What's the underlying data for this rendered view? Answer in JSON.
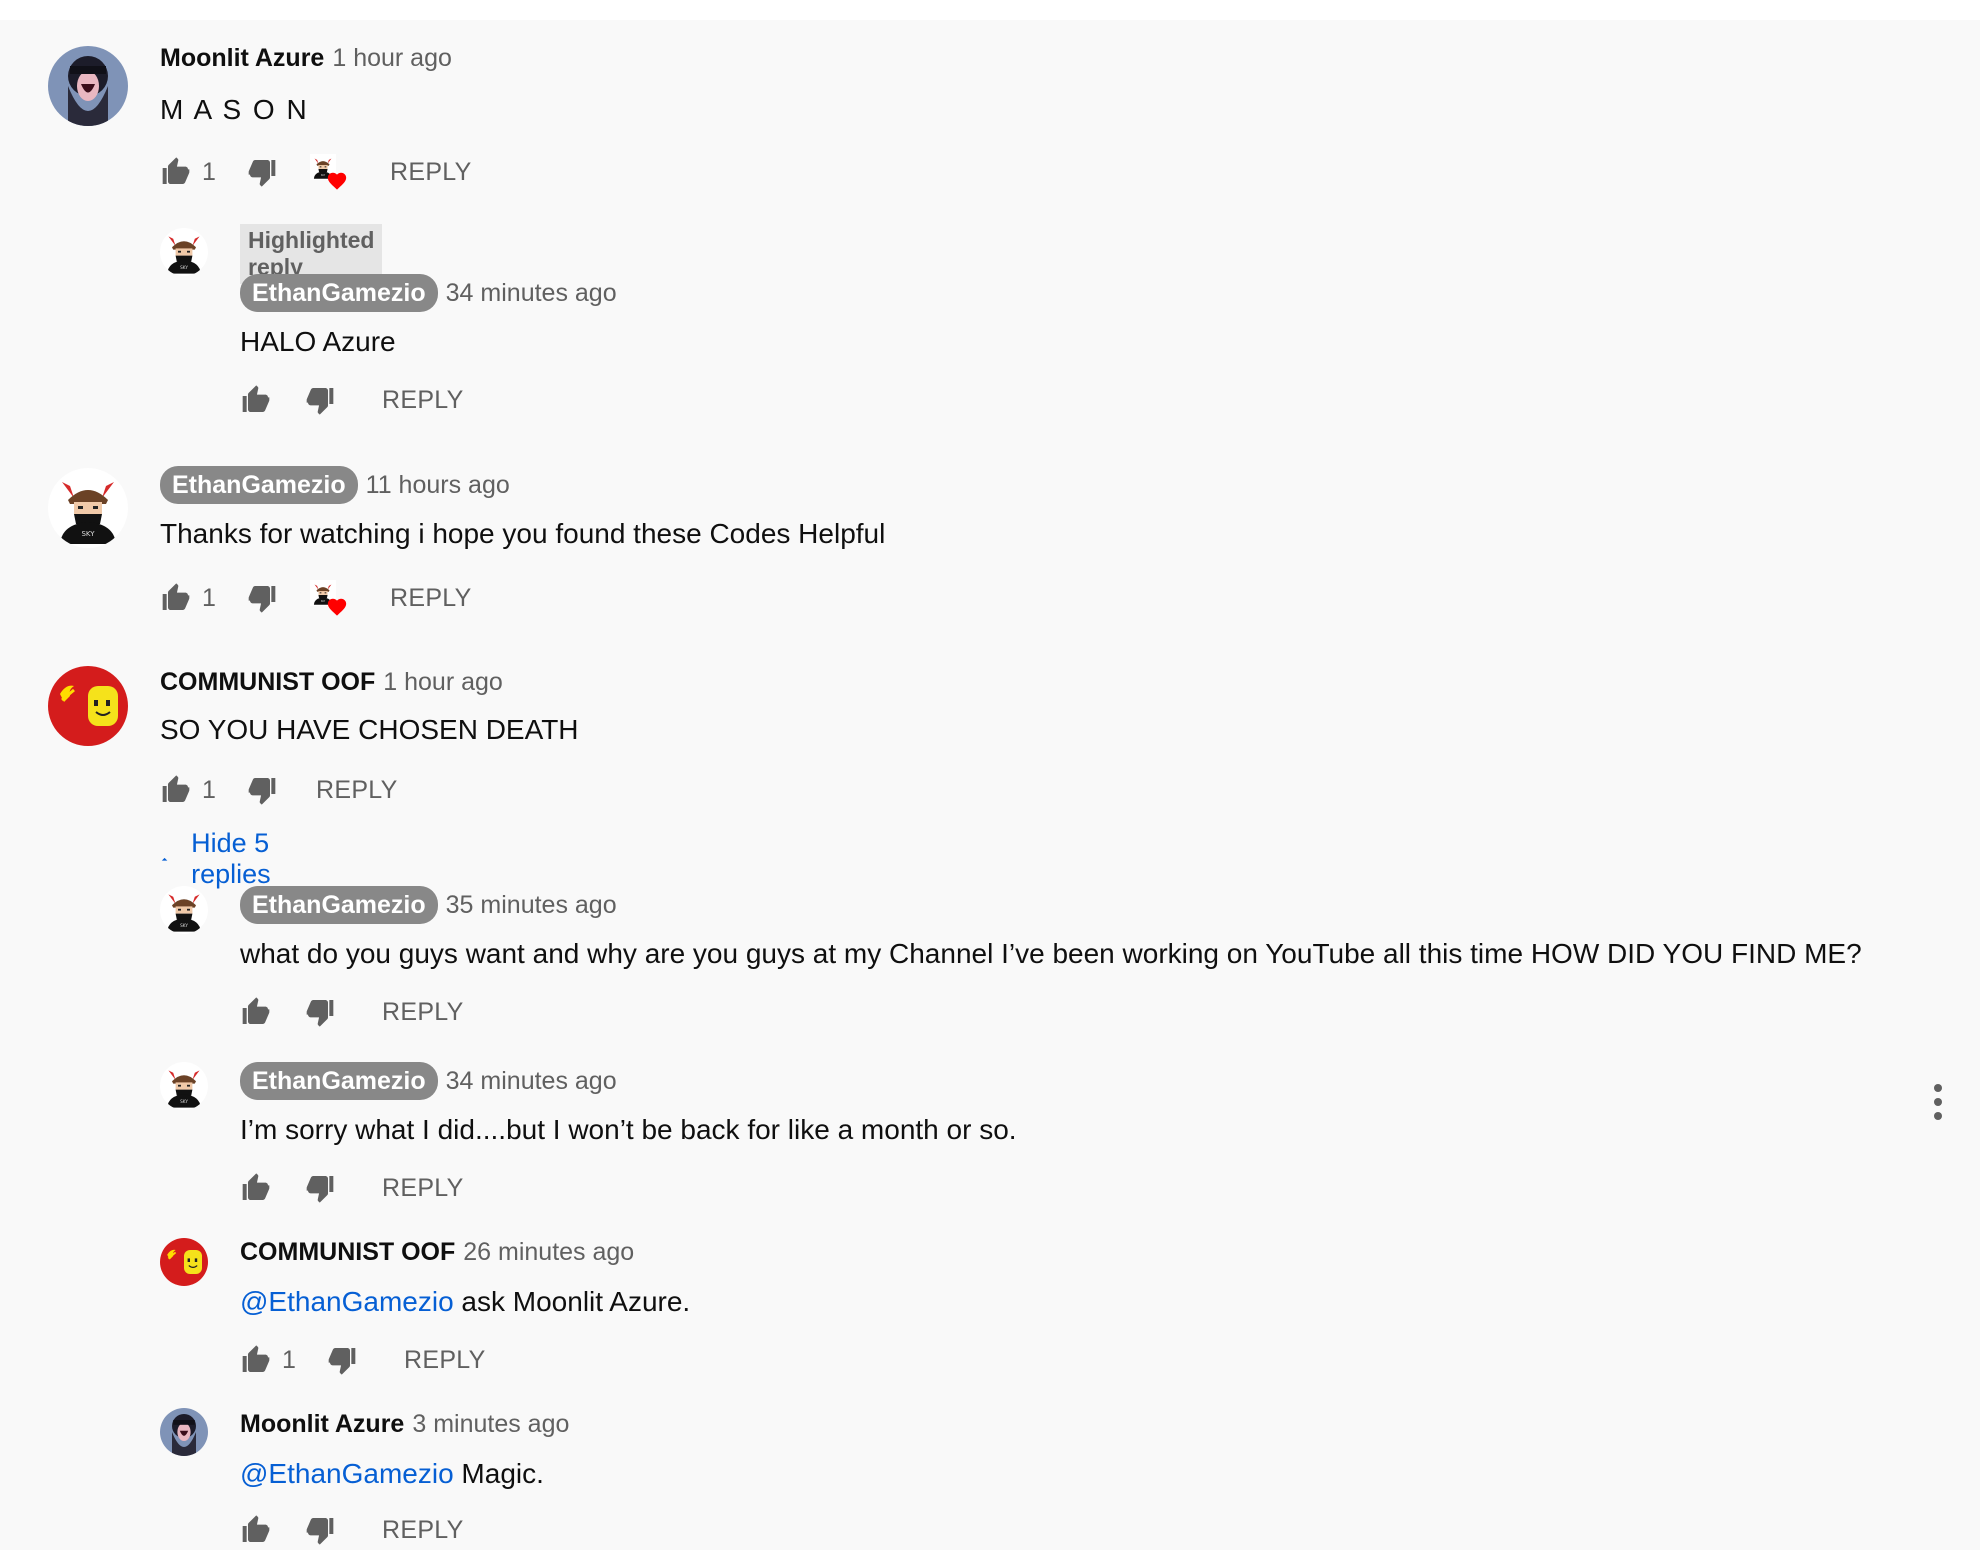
{
  "labels": {
    "reply": "REPLY",
    "highlighted": "Highlighted reply"
  },
  "colors": {
    "link": "#065fd4",
    "muted": "#606060",
    "badge_bg": "#888888"
  },
  "comments": [
    {
      "author": "Moonlit Azure",
      "time": "1 hour ago",
      "text": "M A S O N",
      "likes": "1",
      "creator_hearted": true,
      "avatar_icon": "moonlit-avatar",
      "replies": [
        {
          "author": "EthanGamezio",
          "time": "34 minutes ago",
          "text": "HALO Azure",
          "likes": "",
          "highlighted": true,
          "is_creator": true,
          "avatar_icon": "ethan-avatar"
        }
      ]
    },
    {
      "author": "EthanGamezio",
      "time": "11 hours ago",
      "text": "Thanks for watching i hope you found these Codes Helpful",
      "likes": "1",
      "creator_hearted": true,
      "is_creator": true,
      "avatar_icon": "ethan-avatar",
      "replies": []
    },
    {
      "author": "COMMUNIST OOF",
      "time": "1 hour ago",
      "text": "SO YOU HAVE CHOSEN DEATH",
      "likes": "1",
      "creator_hearted": false,
      "avatar_icon": "oof-avatar",
      "hide_replies_label": "Hide 5 replies",
      "replies": [
        {
          "author": "EthanGamezio",
          "time": "35 minutes ago",
          "text": "what do you guys want and why are you guys at my Channel I’ve been working on YouTube all this time HOW DID YOU FIND ME?",
          "likes": "",
          "is_creator": true,
          "avatar_icon": "ethan-avatar"
        },
        {
          "author": "EthanGamezio",
          "time": "34 minutes ago",
          "text": "I’m sorry what I did....but I won’t be back for like a month or so.",
          "likes": "",
          "is_creator": true,
          "avatar_icon": "ethan-avatar"
        },
        {
          "author": "COMMUNIST OOF",
          "time": "26 minutes ago",
          "mention": "@EthanGamezio",
          "text": " ask Moonlit Azure.",
          "likes": "1",
          "avatar_icon": "oof-avatar"
        },
        {
          "author": "Moonlit Azure",
          "time": "3 minutes ago",
          "mention": "@EthanGamezio",
          "text": " Magic.",
          "likes": "",
          "avatar_icon": "moonlit-avatar"
        }
      ]
    }
  ]
}
